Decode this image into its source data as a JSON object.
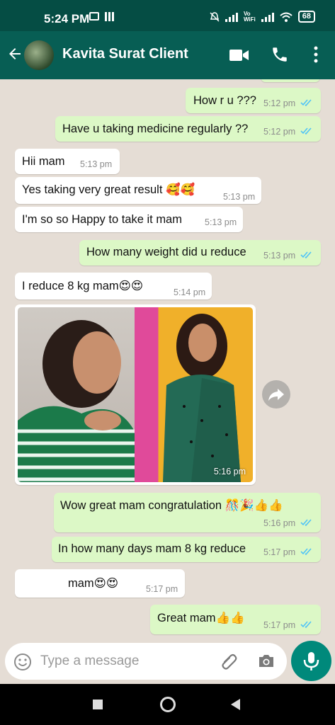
{
  "status_bar": {
    "time": "5:24 PM",
    "battery": "68"
  },
  "header": {
    "contact_name": "Kavita Surat Client"
  },
  "messages": [
    {
      "text": "How r u ???",
      "time": "5:12 pm"
    },
    {
      "text": "Have u taking medicine regularly ??",
      "time": "5:12 pm"
    },
    {
      "text": "Hii mam",
      "time": "5:13 pm"
    },
    {
      "text": "Yes taking very great result 🥰🥰",
      "time": "5:13 pm"
    },
    {
      "text": "I'm so so Happy to take it mam",
      "time": "5:13 pm"
    },
    {
      "text": "How many weight did u reduce",
      "time": "5:13 pm"
    },
    {
      "text": "I reduce 8 kg mam😍😍",
      "time": "5:14 pm"
    },
    {
      "text": "Wow great mam congratulation 🎊🎉👍👍",
      "time": "5:16 pm"
    },
    {
      "text": "In how many days mam 8 kg reduce",
      "time": "5:17 pm"
    },
    {
      "text": "mam😍😍",
      "time": "5:17 pm"
    },
    {
      "text": "Great mam👍👍",
      "time": "5:17 pm"
    }
  ],
  "photo": {
    "time": "5:16 pm"
  },
  "input": {
    "placeholder": "Type a message"
  },
  "colors": {
    "header": "#075e54",
    "status_bar": "#054d44",
    "outgoing": "#dcf8c6",
    "incoming": "#ffffff",
    "read_ticks": "#4fc3f7",
    "mic_button": "#00897b"
  },
  "icons": [
    "back-arrow-icon",
    "video-call-icon",
    "phone-icon",
    "more-vert-icon",
    "forward-icon",
    "emoji-icon",
    "attach-icon",
    "camera-icon",
    "mic-icon"
  ]
}
